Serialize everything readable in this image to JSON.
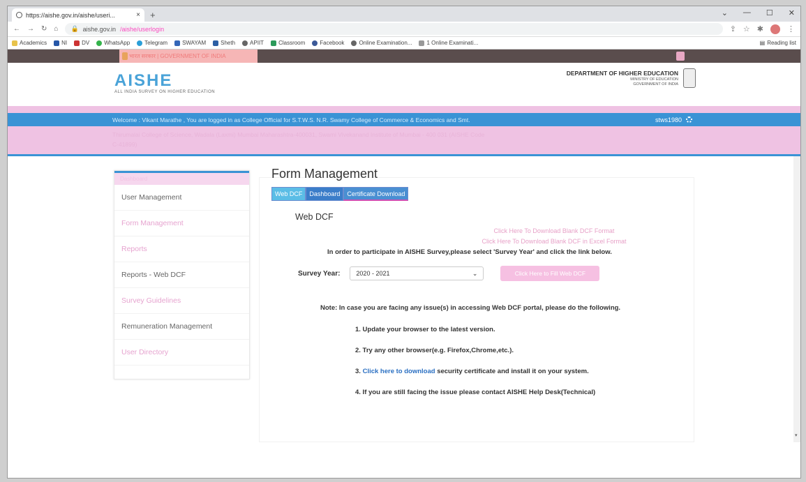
{
  "browser": {
    "tab_title": "https://aishe.gov.in/aishe/useri...",
    "tab_close": "×",
    "new_tab": "+",
    "address": "aishe.gov.in",
    "address_path": "/aishe/userlogin",
    "reading_list": "Reading list",
    "bookmarks": [
      "Academics",
      "NI",
      "DV",
      "WhatsApp",
      "Telegram",
      "SWAYAM",
      "Sheth",
      "APIIT",
      "Classroom",
      "Facebook",
      "Online Examination...",
      "1 Online Examinati..."
    ]
  },
  "site": {
    "gov_strip": "भारत सरकार | GOVERNMENT OF INDIA",
    "logo": "AISHE",
    "logo_sub": "ALL INDIA SURVEY ON HIGHER EDUCATION",
    "dept_line1": "DEPARTMENT OF HIGHER EDUCATION",
    "dept_line2": "MINISTRY OF EDUCATION",
    "dept_line3": "GOVERNMENT OF INDIA",
    "welcome": "Welcome : Vikant Marathe , You are logged in as College Official for S.T.W.S. N.R. Swamy College of Commerce & Economics and Smt.",
    "user_id": "stws1980",
    "institute_line": "Thirumalai College of Science, Wadala (Laxmi) Mumbai Maharashtra-400031, Swami Vivekanand Institute of Mumbai - 400 031 (AISHE Code",
    "institute_line2": "C-41899)"
  },
  "sidebar": {
    "header": "Dashboard",
    "items": [
      {
        "label": "User Management"
      },
      {
        "label": "Form Management"
      },
      {
        "label": "Reports"
      },
      {
        "label": "Reports - Web DCF"
      },
      {
        "label": "Survey Guidelines"
      },
      {
        "label": "Remuneration Management"
      },
      {
        "label": "User Directory"
      }
    ]
  },
  "main": {
    "title": "Form Management",
    "tabs": [
      "Web DCF",
      "Dashboard",
      "Certificate Download"
    ],
    "section_title": "Web DCF",
    "download_link_1": "Click Here To Download Blank DCF Format",
    "download_link_2": "Click Here To Download Blank DCF in Excel Format",
    "instruction": "In order to participate in AISHE Survey,please select 'Survey Year' and click the link below.",
    "survey_label": "Survey Year:",
    "survey_value": "2020 - 2021",
    "fill_button": "Click Here to Fill Web DCF",
    "note": "Note: In case you are facing any issue(s) in accessing Web DCF portal, please do the following.",
    "step1": "1. Update your browser to the latest version.",
    "step2": "2. Try any other browser(e.g. Firefox,Chrome,etc.).",
    "step3_prefix": "3. ",
    "step3_link": "Click here to download",
    "step3_suffix": " security certificate and install it on your system.",
    "step4": "4. If you are still facing the issue please contact AISHE Help Desk(Technical)"
  }
}
